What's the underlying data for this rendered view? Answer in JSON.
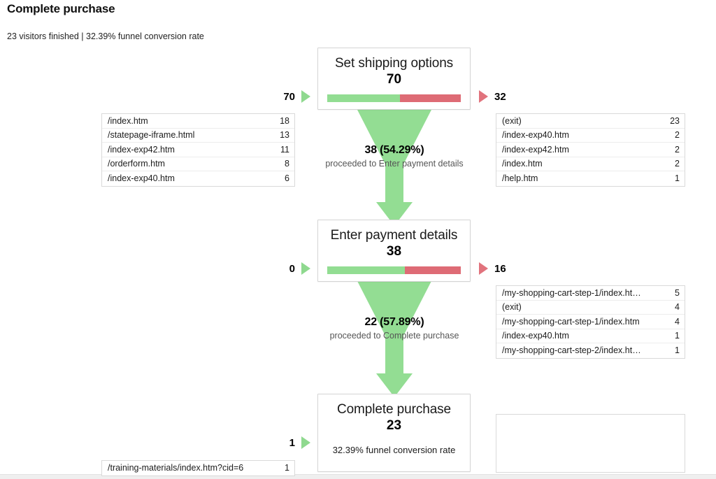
{
  "header": {
    "title": "Complete purchase",
    "subtitle": "23 visitors finished | 32.39% funnel conversion rate"
  },
  "colors": {
    "green": "#92dd92",
    "red": "#de6b75",
    "entry_triangle": "#8fd98f",
    "exit_triangle": "#e1737d",
    "box_border": "#d4d4d4",
    "row_border": "#ededed"
  },
  "steps": [
    {
      "name": "Set shipping options",
      "count": "70",
      "proceeded_pct": 54.29,
      "entry_count": "70",
      "exit_count": "32",
      "entry_rows": [
        {
          "label": "/index.htm",
          "value": "18"
        },
        {
          "label": "/statepage-iframe.html",
          "value": "13"
        },
        {
          "label": "/index-exp42.htm",
          "value": "11"
        },
        {
          "label": "/orderform.htm",
          "value": "8"
        },
        {
          "label": "/index-exp40.htm",
          "value": "6"
        }
      ],
      "exit_rows": [
        {
          "label": "(exit)",
          "value": "23"
        },
        {
          "label": "/index-exp40.htm",
          "value": "2"
        },
        {
          "label": "/index-exp42.htm",
          "value": "2"
        },
        {
          "label": "/index.htm",
          "value": "2"
        },
        {
          "label": "/help.htm",
          "value": "1"
        }
      ]
    },
    {
      "name": "Enter payment details",
      "count": "38",
      "proceeded_pct": 57.89,
      "entry_count": "0",
      "exit_count": "16",
      "entry_rows": [],
      "exit_rows": [
        {
          "label": "/my-shopping-cart-step-1/index.ht…",
          "value": "5"
        },
        {
          "label": "(exit)",
          "value": "4"
        },
        {
          "label": "/my-shopping-cart-step-1/index.htm",
          "value": "4"
        },
        {
          "label": "/index-exp40.htm",
          "value": "1"
        },
        {
          "label": "/my-shopping-cart-step-2/index.ht…",
          "value": "1"
        }
      ]
    },
    {
      "name": "Complete purchase",
      "count": "23",
      "rate_text": "32.39% funnel conversion rate",
      "entry_count": "1",
      "entry_rows": [
        {
          "label": "/training-materials/index.htm?cid=6",
          "value": "1"
        }
      ],
      "exit_rows": []
    }
  ],
  "connectors": [
    {
      "main": "38 (54.29%)",
      "sub": "proceeded to Enter payment details"
    },
    {
      "main": "22 (57.89%)",
      "sub": "proceeded to Complete purchase"
    }
  ]
}
